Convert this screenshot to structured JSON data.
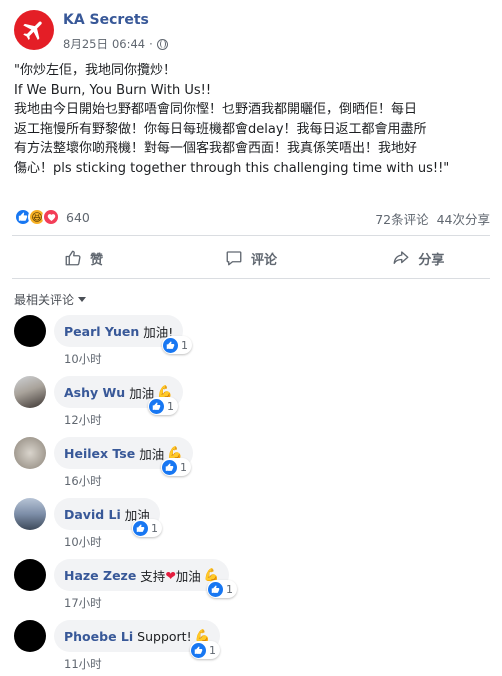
{
  "post": {
    "page_name": "KA Secrets",
    "date": "8月25日",
    "time": "06:44",
    "dot": "·",
    "lines": [
      "\"你炒左佢，我地同你攬炒！",
      "If We Burn, You Burn With Us!!",
      "我地由今日開始乜野都唔會同你慳！乜野酒我都開曬佢，倒晒佢！每日",
      "返工拖慢所有野黎做！你每日每班機都會delay！我每日返工都會用盡所",
      "有方法整壞你啲飛機！對每一個客我都會西面！我真係笑唔出！我地好",
      "傷心！pls sticking together through this challenging time with us!!\""
    ],
    "reaction_count": "640",
    "comments_count": "72条评论",
    "shares_count": "44次分享"
  },
  "actions": {
    "like": "赞",
    "comment": "评论",
    "share": "分享"
  },
  "sort_label": "最相关评论",
  "comments": [
    {
      "name": "Pearl Yuen",
      "text": "加油!",
      "likes": "1",
      "time": "10小时"
    },
    {
      "name": "Ashy Wu",
      "text": "加油",
      "likes": "1",
      "time": "12小时"
    },
    {
      "name": "Heilex Tse",
      "text": "加油",
      "likes": "1",
      "time": "16小时"
    },
    {
      "name": "David Li",
      "text": "加油",
      "likes": "1",
      "time": "10小时"
    },
    {
      "name": "Haze Zeze",
      "text_before": "支持",
      "text_after": "加油",
      "likes": "1",
      "time": "17小时"
    },
    {
      "name": "Phoebe Li",
      "text": "Support!",
      "likes": "1",
      "time": "11小时"
    }
  ],
  "colors": {
    "link_blue": "#385898",
    "like_blue": "#1877f2",
    "brand_red": "#e41e26",
    "muted": "#606770"
  }
}
